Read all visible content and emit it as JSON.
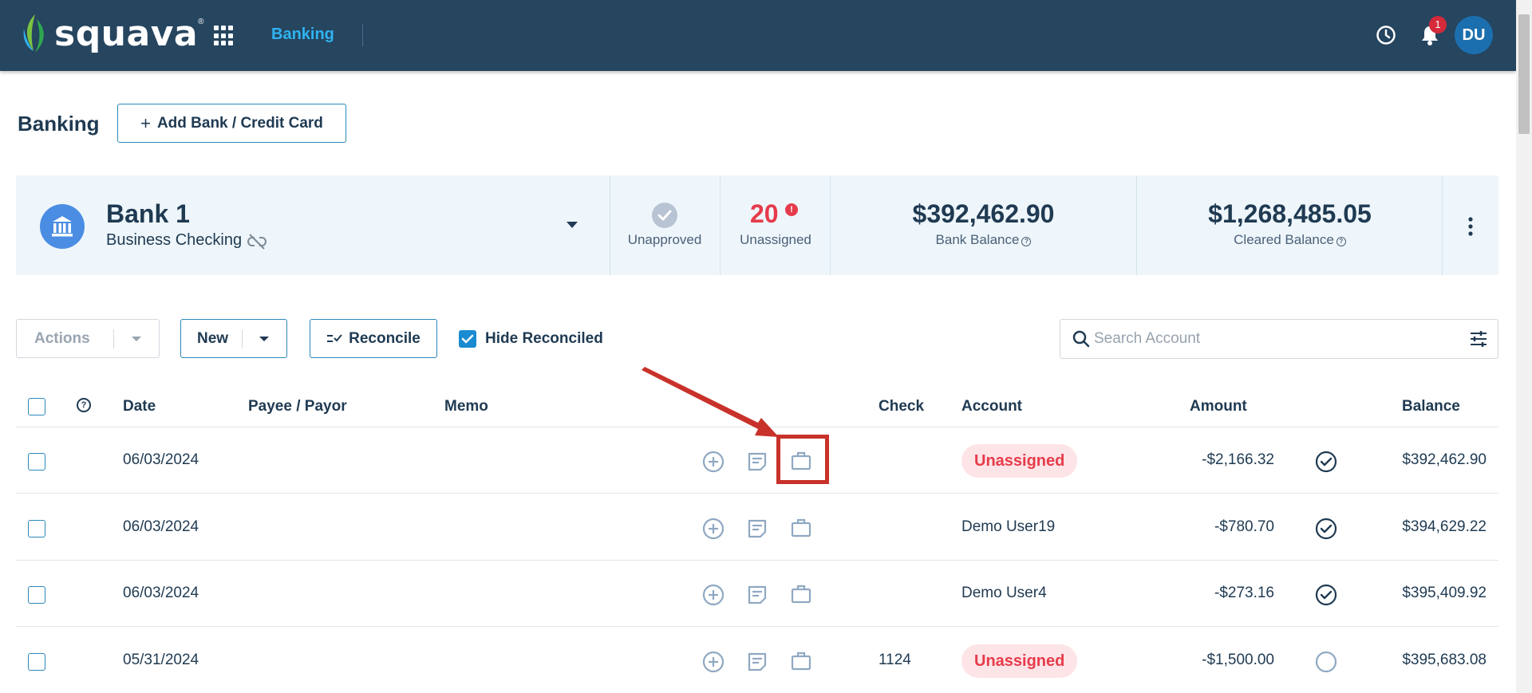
{
  "nav": {
    "logo_text": "squava",
    "logo_reg": "®",
    "active_link": "Banking",
    "notification_count": "1",
    "avatar_initials": "DU"
  },
  "page": {
    "title": "Banking",
    "add_button": "Add Bank / Credit Card"
  },
  "account": {
    "name": "Bank 1",
    "type": "Business Checking",
    "unapproved_label": "Unapproved",
    "unassigned_count": "20",
    "unassigned_label": "Unassigned",
    "bank_balance": "$392,462.90",
    "bank_balance_label": "Bank Balance",
    "cleared_balance": "$1,268,485.05",
    "cleared_balance_label": "Cleared Balance"
  },
  "toolbar": {
    "actions_label": "Actions",
    "new_label": "New",
    "reconcile_label": "Reconcile",
    "hide_reconciled_label": "Hide Reconciled",
    "hide_reconciled_checked": true,
    "search_placeholder": "Search Account"
  },
  "table": {
    "columns": {
      "help": "?",
      "date": "Date",
      "payee": "Payee / Payor",
      "memo": "Memo",
      "check": "Check",
      "account": "Account",
      "amount": "Amount",
      "balance": "Balance"
    },
    "rows": [
      {
        "date": "06/03/2024",
        "check": "",
        "account": "Unassigned",
        "account_unassigned": true,
        "amount": "-$2,166.32",
        "cleared": true,
        "balance": "$392,462.90"
      },
      {
        "date": "06/03/2024",
        "check": "",
        "account": "Demo User19",
        "account_unassigned": false,
        "amount": "-$780.70",
        "cleared": true,
        "balance": "$394,629.22"
      },
      {
        "date": "06/03/2024",
        "check": "",
        "account": "Demo User4",
        "account_unassigned": false,
        "amount": "-$273.16",
        "cleared": true,
        "balance": "$395,409.92"
      },
      {
        "date": "05/31/2024",
        "check": "1124",
        "account": "Unassigned",
        "account_unassigned": true,
        "amount": "-$1,500.00",
        "cleared": false,
        "balance": "$395,683.08"
      }
    ]
  },
  "colors": {
    "topbar": "#26455f",
    "accent": "#2c88b8",
    "danger": "#e63b4b",
    "annotation": "#c8322a"
  }
}
